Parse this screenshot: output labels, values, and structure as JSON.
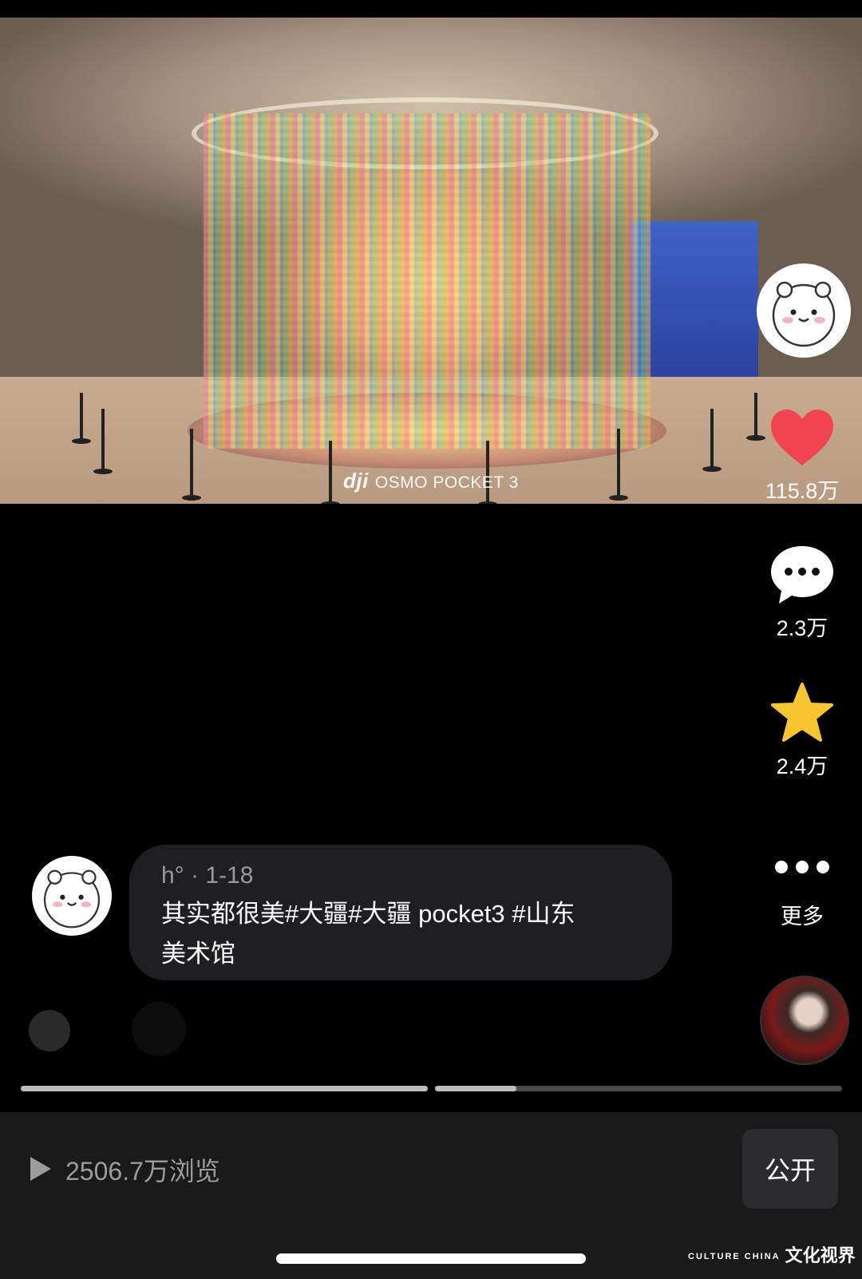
{
  "video": {
    "watermark_brand": "dji",
    "watermark_text": "OSMO POCKET 3"
  },
  "actions": {
    "likes": "115.8万",
    "comments": "2.3万",
    "favorites": "2.4万",
    "more_label": "更多"
  },
  "caption": {
    "author": "h°",
    "date": "· 1-18",
    "text_line1": "其实都很美#大疆#大疆 pocket3 #山东",
    "text_line2": "美术馆"
  },
  "progress": {
    "segments": [
      {
        "fill": 1.0
      },
      {
        "fill": 0.2
      }
    ]
  },
  "bottom_bar": {
    "views": "2506.7万浏览",
    "public_button": "公开"
  },
  "corner_logo": {
    "small": "CULTURE CHINA",
    "text": "文化视界"
  },
  "colors": {
    "like": "#f0454f",
    "favorite": "#f7c531",
    "bubble": "#1f1f21",
    "bottom_bar": "#1a1a1a"
  }
}
